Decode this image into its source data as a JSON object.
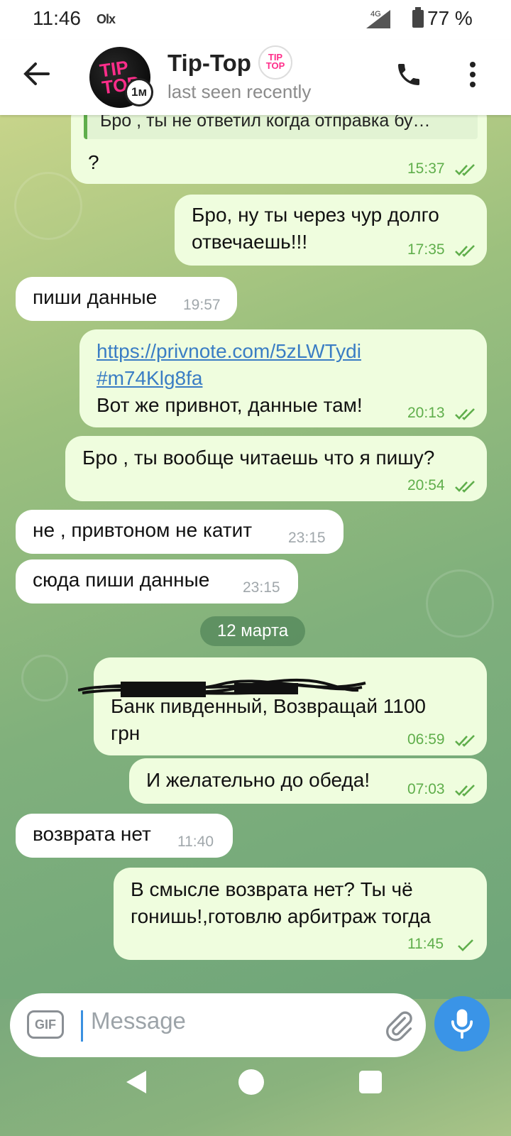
{
  "status_bar": {
    "time": "11:46",
    "app_icon": "olx-icon",
    "network": "4G",
    "battery": "77 %"
  },
  "header": {
    "title": "Tip-Top",
    "subtitle": "last seen recently",
    "badge": "1м"
  },
  "messages": [
    {
      "dir": "out",
      "reply_preview": "Бро , ты не ответил когда отправка бу…",
      "text": "?",
      "time": "15:37",
      "status": "read"
    },
    {
      "dir": "out",
      "lines": [
        "Бро, ну ты через чур долго",
        "отвечаешь!!!"
      ],
      "time": "17:35",
      "status": "read"
    },
    {
      "dir": "in",
      "text": "пиши данные",
      "time": "19:57"
    },
    {
      "dir": "out",
      "link": [
        "https://privnote.com/5zLWTydi",
        "#m74Klg8fa"
      ],
      "text": "Вот же привнот, данные там!",
      "time": "20:13",
      "status": "read"
    },
    {
      "dir": "out",
      "text": "Бро , ты вообще читаешь что я пишу?",
      "time": "20:54",
      "status": "read"
    },
    {
      "dir": "in",
      "text": "не , привтоном не катит",
      "time": "23:15"
    },
    {
      "dir": "in",
      "text": "сюда пиши данные",
      "time": "23:15"
    },
    {
      "dir": "out",
      "lines": [
        "Банк пивденный, Возвращай 1100",
        "грн"
      ],
      "time": "06:59",
      "status": "read",
      "redacted": true
    },
    {
      "dir": "out",
      "text": "И желательно до обеда!",
      "time": "07:03",
      "status": "read"
    },
    {
      "dir": "in",
      "text": "возврата нет",
      "time": "11:40"
    },
    {
      "dir": "out",
      "lines": [
        "В смысле возврата нет? Ты чё",
        "гонишь!,готовлю арбитраж тогда"
      ],
      "time": "11:45",
      "status": "sent"
    }
  ],
  "date_separator": "12 марта",
  "input": {
    "placeholder": "Message",
    "gif_label": "GIF"
  },
  "colors": {
    "outgoing_bubble": "#effdde",
    "incoming_bubble": "#ffffff",
    "accent": "#3a94e7",
    "tick_green": "#5fae4b"
  }
}
